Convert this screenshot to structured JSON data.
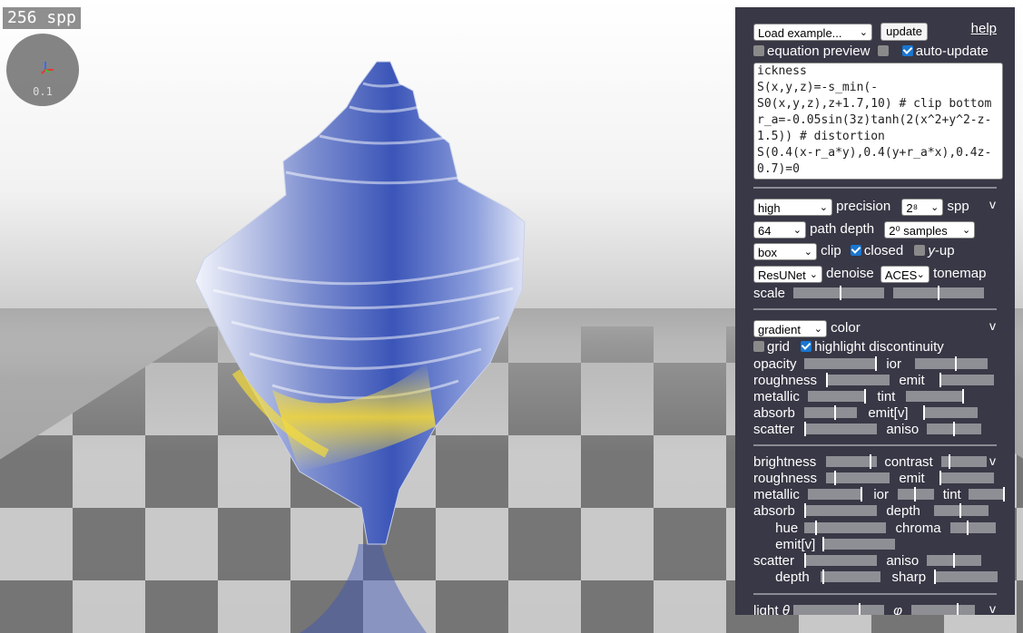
{
  "viewport": {
    "spp_badge": "256 spp",
    "axes_scale": "0.1"
  },
  "panel": {
    "load_example": "Load example...",
    "update": "update",
    "help": "help",
    "equation_preview": "equation preview",
    "auto_update": "auto-update",
    "code": "ickness\nS(x,y,z)=-s_min(-S0(x,y,z),z+1.7,10) # clip bottom\nr_a=-0.05sin(3z)tanh(2(x^2+y^2-z-1.5)) # distortion\nS(0.4(x-r_a*y),0.4(y+r_a*x),0.4z-0.7)=0",
    "render": {
      "precision_value": "high",
      "precision_label": "precision",
      "spp_value": "2⁸",
      "spp_label": "spp",
      "toggle": "v",
      "depth_value": "64",
      "depth_label": "path depth",
      "samples_value": "2⁰ samples",
      "clip_value": "box",
      "clip_label": "clip",
      "closed_label": "closed",
      "yup_label": "y-up",
      "yup_prefix": "y",
      "yup_suffix": "-up",
      "denoise_value": "ResUNet",
      "denoise_label": "denoise",
      "tonemap_value": "ACES",
      "tonemap_label": "tonemap",
      "scale_label": "scale"
    },
    "material": {
      "color_value": "gradient",
      "color_label": "color",
      "toggle": "v",
      "grid_label": "grid",
      "highlight_label": "highlight discontinuity",
      "opacity": "opacity",
      "ior": "ior",
      "roughness": "roughness",
      "emit": "emit",
      "metallic": "metallic",
      "tint": "tint",
      "absorb": "absorb",
      "emit_v": "emit[v]",
      "scatter": "scatter",
      "aniso": "aniso"
    },
    "background": {
      "brightness": "brightness",
      "contrast": "contrast",
      "toggle": "v",
      "roughness": "roughness",
      "emit": "emit",
      "metallic": "metallic",
      "ior": "ior",
      "tint": "tint",
      "absorb": "absorb",
      "depth": "depth",
      "hue": "hue",
      "chroma": "chroma",
      "emit_v": "emit[v]",
      "scatter": "scatter",
      "aniso": "aniso",
      "depth2": "depth",
      "sharp": "sharp"
    },
    "light": {
      "label": "light",
      "theta": "θ",
      "phi": "φ",
      "toggle": "v"
    }
  },
  "colors": {
    "panel_bg": "#383846",
    "accent": "#1976d2",
    "slider": "#8e8e95"
  },
  "icons": [
    "chevron-down-icon",
    "checkbox-icon",
    "axes-gizmo-icon",
    "resize-grip-icon"
  ]
}
